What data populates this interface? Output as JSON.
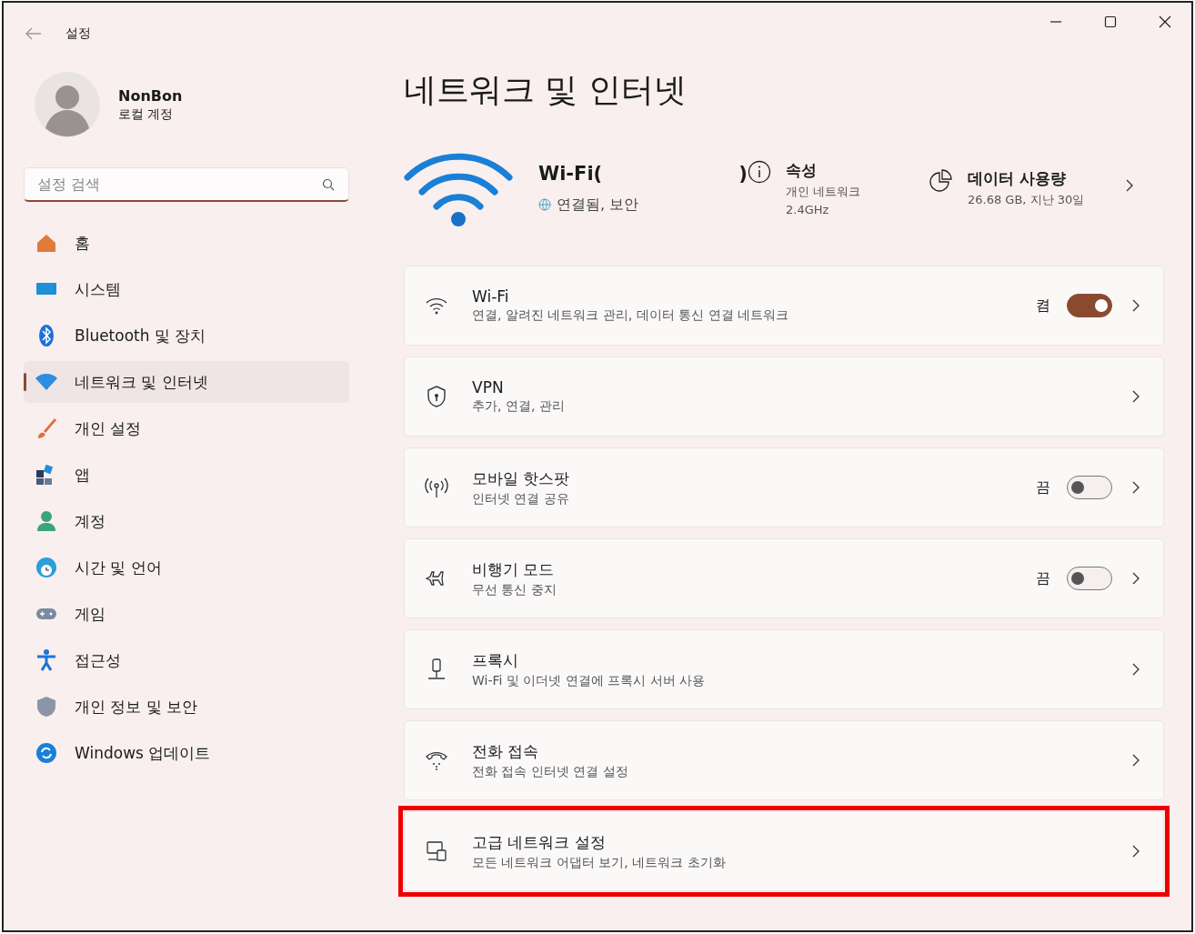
{
  "window": {
    "title": "설정"
  },
  "account": {
    "name": "NonBon",
    "type": "로컬 계정"
  },
  "search": {
    "placeholder": "설정 검색"
  },
  "sidebar": {
    "items": [
      {
        "label": "홈",
        "selected": false
      },
      {
        "label": "시스템",
        "selected": false
      },
      {
        "label": "Bluetooth 및 장치",
        "selected": false
      },
      {
        "label": "네트워크 및 인터넷",
        "selected": true
      },
      {
        "label": "개인 설정",
        "selected": false
      },
      {
        "label": "앱",
        "selected": false
      },
      {
        "label": "계정",
        "selected": false
      },
      {
        "label": "시간 및 언어",
        "selected": false
      },
      {
        "label": "게임",
        "selected": false
      },
      {
        "label": "접근성",
        "selected": false
      },
      {
        "label": "개인 정보 및 보안",
        "selected": false
      },
      {
        "label": "Windows 업데이트",
        "selected": false
      }
    ]
  },
  "page": {
    "title": "네트워크 및 인터넷"
  },
  "connection": {
    "name_start": "Wi-Fi(",
    "name_end": ")",
    "status": "연결됨, 보안",
    "properties": {
      "title": "속성",
      "lines": [
        "개인 네트워크",
        "2.4GHz"
      ]
    },
    "data_usage": {
      "title": "데이터 사용량",
      "detail": "26.68 GB, 지난 30일"
    }
  },
  "settings": [
    {
      "title": "Wi-Fi",
      "subtitle": "연결, 알려진 네트워크 관리, 데이터 통신 연결 네트워크",
      "kind": "toggle",
      "state_label": "켬",
      "on": true,
      "highlighted": false
    },
    {
      "title": "VPN",
      "subtitle": "추가, 연결, 관리",
      "kind": "link",
      "highlighted": false
    },
    {
      "title": "모바일 핫스팟",
      "subtitle": "인터넷 연결 공유",
      "kind": "toggle",
      "state_label": "끔",
      "on": false,
      "highlighted": false
    },
    {
      "title": "비행기 모드",
      "subtitle": "무선 통신 중지",
      "kind": "toggle",
      "state_label": "끔",
      "on": false,
      "highlighted": false
    },
    {
      "title": "프록시",
      "subtitle": "Wi-Fi 및 이더넷 연결에 프록시 서버 사용",
      "kind": "link",
      "highlighted": false
    },
    {
      "title": "전화 접속",
      "subtitle": "전화 접속 인터넷 연결 설정",
      "kind": "link",
      "highlighted": false
    },
    {
      "title": "고급 네트워크 설정",
      "subtitle": "모든 네트워크 어댑터 보기, 네트워크 초기화",
      "kind": "link",
      "highlighted": true
    }
  ]
}
